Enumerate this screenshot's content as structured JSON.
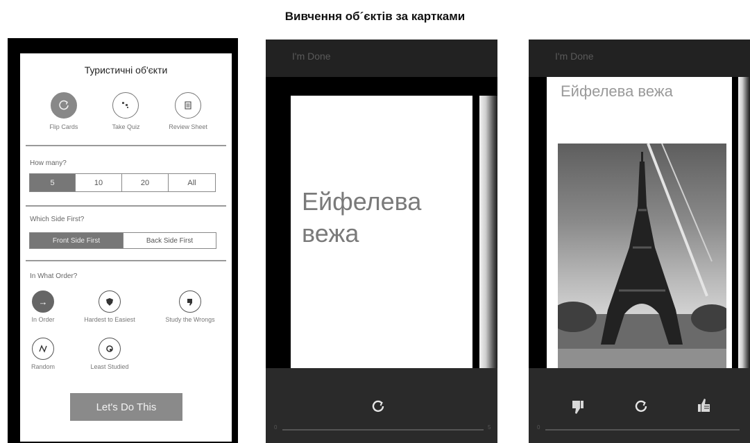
{
  "page_title": "Вивчення об´єктів за картками",
  "settings": {
    "title": "Туристичні об'єкти",
    "modes": [
      {
        "label": "Flip Cards",
        "icon": "flip-cards-icon",
        "selected": true
      },
      {
        "label": "Take Quiz",
        "icon": "quiz-icon",
        "selected": false
      },
      {
        "label": "Review Sheet",
        "icon": "review-sheet-icon",
        "selected": false
      }
    ],
    "how_many": {
      "label": "How many?",
      "options": [
        "5",
        "10",
        "20",
        "All"
      ],
      "selected": "5"
    },
    "which_side": {
      "label": "Which Side First?",
      "options": [
        "Front Side First",
        "Back Side First"
      ],
      "selected": "Front Side First"
    },
    "order": {
      "label": "In What Order?",
      "options": [
        {
          "label": "In Order",
          "icon": "arrow-right-icon",
          "selected": true
        },
        {
          "label": "Hardest to Easiest",
          "icon": "shield-icon",
          "selected": false
        },
        {
          "label": "Study the Wrongs",
          "icon": "thumbs-down-icon",
          "selected": false
        },
        {
          "label": "Random",
          "icon": "random-icon",
          "selected": false
        },
        {
          "label": "Least Studied",
          "icon": "least-studied-icon",
          "selected": false
        }
      ]
    },
    "start_button": "Let's Do This"
  },
  "card_front": {
    "done_label": "I'm Done",
    "word_line1": "Ейфелева",
    "word_line2": "вежа",
    "progress_start": "0",
    "progress_end": "5"
  },
  "card_back": {
    "done_label": "I'm Done",
    "word": "Ейфелева вежа",
    "image_icon": "eiffel-tower-photo",
    "progress_start": "0"
  },
  "colors": {
    "selected_fill": "#777777",
    "dark_bar": "#2a2a2a",
    "card_text": "#7a7a7a"
  }
}
